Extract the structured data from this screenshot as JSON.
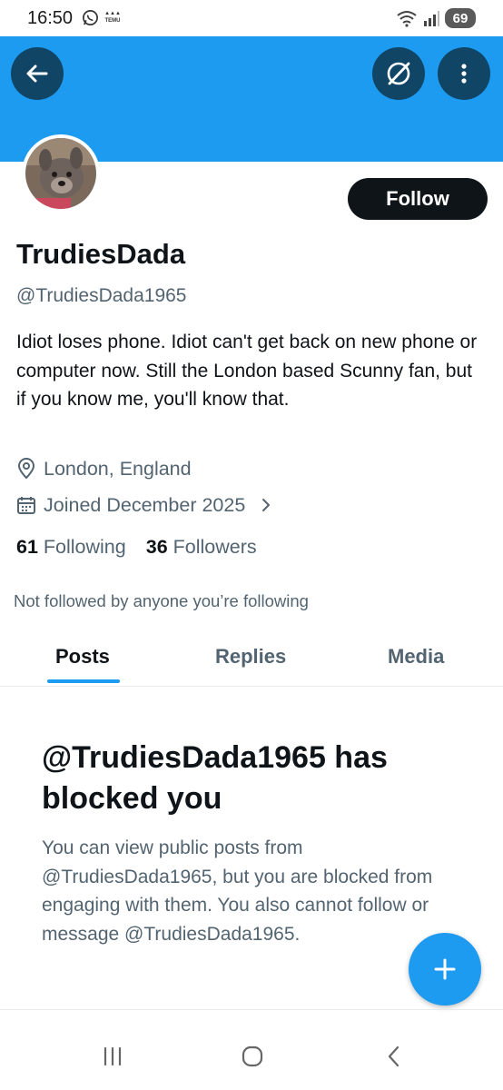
{
  "status_bar": {
    "time": "16:50",
    "temu_label": "TEMU",
    "battery": "69"
  },
  "profile": {
    "display_name": "TrudiesDada",
    "handle": "@TrudiesDada1965",
    "bio": "Idiot loses phone. Idiot can't get back on new phone or computer now. Still the London based Scunny fan, but if you know me, you'll know that.",
    "location": "London, England",
    "joined": "Joined December 2025",
    "following_count": "61",
    "following_label": "Following",
    "followers_count": "36",
    "followers_label": "Followers",
    "not_followed_text": "Not followed by anyone you’re following",
    "follow_button": "Follow"
  },
  "tabs": [
    {
      "label": "Posts",
      "active": true
    },
    {
      "label": "Replies",
      "active": false
    },
    {
      "label": "Media",
      "active": false
    }
  ],
  "blocked": {
    "title": "@TrudiesDada1965 has blocked you",
    "text": "You can view public posts from @TrudiesDada1965, but you are blocked from engaging with them. You also cannot follow or message @TrudiesDada1965."
  },
  "colors": {
    "banner": "#1d9bf0",
    "accent": "#1d9bf0",
    "text_primary": "#0f1419",
    "text_secondary": "#536471"
  },
  "icons": {
    "back": "arrow-left-icon",
    "grok": "grok-icon",
    "more": "more-vertical-icon",
    "location": "location-pin-icon",
    "calendar": "calendar-icon",
    "chevron": "chevron-right-icon",
    "fab": "plus-icon"
  }
}
